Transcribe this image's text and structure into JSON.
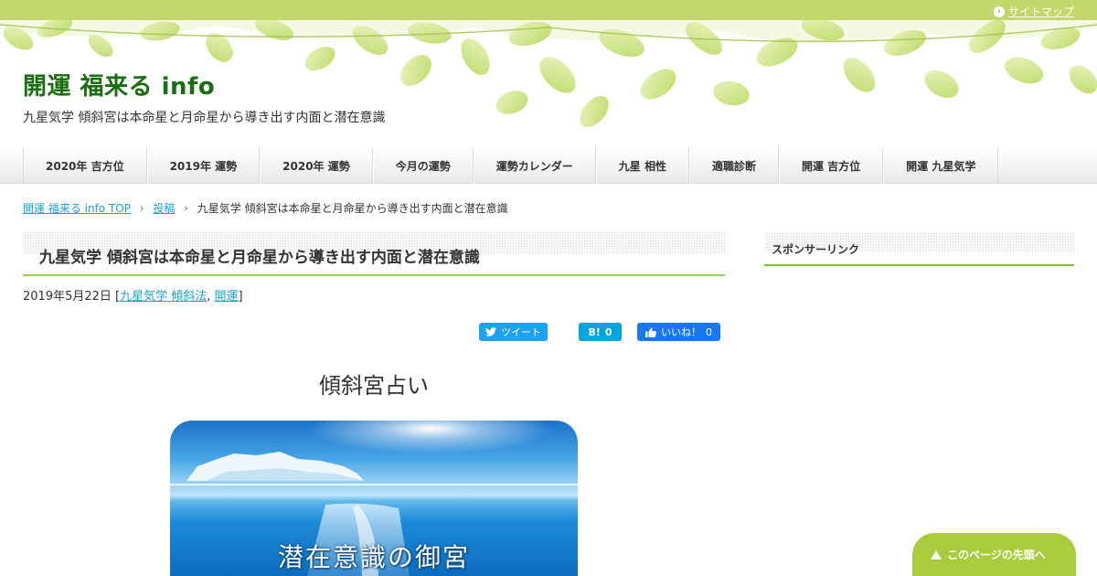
{
  "topbar": {
    "sitemap_label": "サイトマップ"
  },
  "header": {
    "site_title": "開運 福来る info",
    "site_description": "九星気学 傾斜宮は本命星と月命星から導き出す内面と潜在意識"
  },
  "nav": {
    "items": [
      "2020年 吉方位",
      "2019年 運勢",
      "2020年 運勢",
      "今月の運勢",
      "運勢カレンダー",
      "九星 相性",
      "適職診断",
      "開運 吉方位",
      "開運 九星気学"
    ]
  },
  "breadcrumb": {
    "home": "開運 福来る info TOP",
    "category": "投稿",
    "current": "九星気学 傾斜宮は本命星と月命星から導き出す内面と潜在意識"
  },
  "post": {
    "title": "九星気学 傾斜宮は本命星と月命星から導き出す内面と潜在意識",
    "date": "2019年5月22日",
    "meta_open": " [",
    "categories": [
      "九星気学 傾斜法",
      "開運"
    ],
    "meta_sep": ", ",
    "meta_close": "]",
    "lead": "傾斜宮占い",
    "hero_text": "潜在意識の御宮"
  },
  "share": {
    "tweet_label": "ツイート",
    "hatena_label": "B!",
    "hatena_count": "0",
    "like_label": "いいね！",
    "like_count": "0"
  },
  "sidebar": {
    "title": "スポンサーリンク"
  },
  "pagetop": {
    "label": "このページの先頭へ"
  },
  "colors": {
    "topbar": "#c3d86a",
    "title_green": "#1a6e12",
    "link": "#1aa3c8",
    "accent_line": "#9ccf5a",
    "pagetop": "#a8cc3c"
  }
}
